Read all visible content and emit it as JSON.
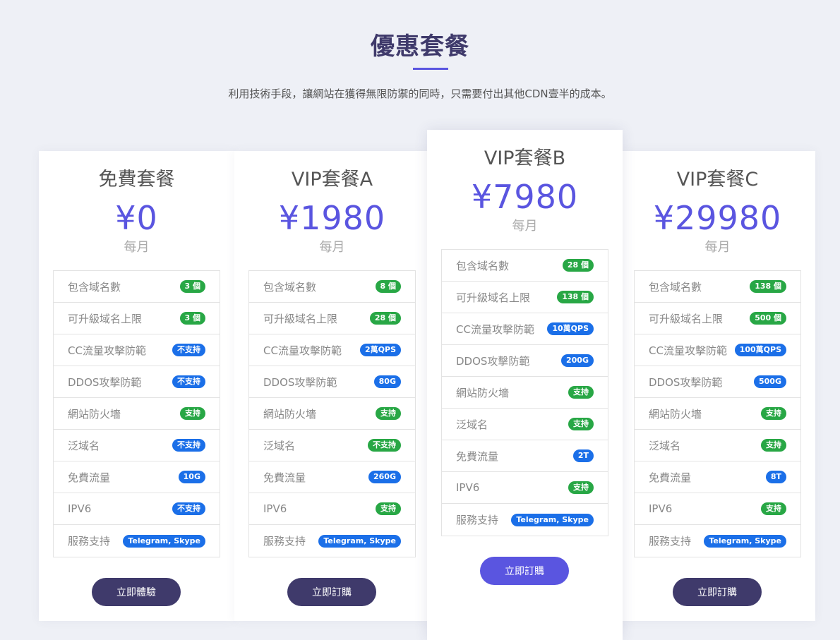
{
  "section": {
    "title": "優惠套餐",
    "subtitle": "利用技術手段，讓網站在獲得無限防禦的同時，只需要付出其他CDN壹半的成本。"
  },
  "colors": {
    "accent": "#5a55e0",
    "button_dark": "#3f3a6b",
    "badge_green": "#28a745",
    "badge_blue": "#1b6fe8"
  },
  "plans": [
    {
      "name": "免費套餐",
      "price": "¥0",
      "period": "每月",
      "button": "立即體驗",
      "features": [
        {
          "label": "包含域名數",
          "value": "3 個",
          "color": "green"
        },
        {
          "label": "可升級域名上限",
          "value": "3 個",
          "color": "green"
        },
        {
          "label": "CC流量攻擊防範",
          "value": "不支持",
          "color": "blue"
        },
        {
          "label": "DDOS攻擊防範",
          "value": "不支持",
          "color": "blue"
        },
        {
          "label": "網站防火墻",
          "value": "支持",
          "color": "green"
        },
        {
          "label": "泛域名",
          "value": "不支持",
          "color": "blue"
        },
        {
          "label": "免費流量",
          "value": "10G",
          "color": "blue"
        },
        {
          "label": "IPV6",
          "value": "不支持",
          "color": "blue"
        },
        {
          "label": "服務支持",
          "value": "Telegram, Skype",
          "color": "blue"
        }
      ]
    },
    {
      "name": "VIP套餐A",
      "price": "¥1980",
      "period": "每月",
      "button": "立即訂購",
      "features": [
        {
          "label": "包含域名數",
          "value": "8 個",
          "color": "green"
        },
        {
          "label": "可升級域名上限",
          "value": "28 個",
          "color": "green"
        },
        {
          "label": "CC流量攻擊防範",
          "value": "2萬QPS",
          "color": "blue"
        },
        {
          "label": "DDOS攻擊防範",
          "value": "80G",
          "color": "blue"
        },
        {
          "label": "網站防火墻",
          "value": "支持",
          "color": "green"
        },
        {
          "label": "泛域名",
          "value": "不支持",
          "color": "green"
        },
        {
          "label": "免費流量",
          "value": "260G",
          "color": "blue"
        },
        {
          "label": "IPV6",
          "value": "支持",
          "color": "green"
        },
        {
          "label": "服務支持",
          "value": "Telegram, Skype",
          "color": "blue"
        }
      ]
    },
    {
      "name": "VIP套餐B",
      "price": "¥7980",
      "period": "每月",
      "button": "立即訂購",
      "features": [
        {
          "label": "包含域名數",
          "value": "28 個",
          "color": "green"
        },
        {
          "label": "可升級域名上限",
          "value": "138 個",
          "color": "green"
        },
        {
          "label": "CC流量攻擊防範",
          "value": "10萬QPS",
          "color": "blue"
        },
        {
          "label": "DDOS攻擊防範",
          "value": "200G",
          "color": "blue"
        },
        {
          "label": "網站防火墻",
          "value": "支持",
          "color": "green"
        },
        {
          "label": "泛域名",
          "value": "支持",
          "color": "green"
        },
        {
          "label": "免費流量",
          "value": "2T",
          "color": "blue"
        },
        {
          "label": "IPV6",
          "value": "支持",
          "color": "green"
        },
        {
          "label": "服務支持",
          "value": "Telegram, Skype",
          "color": "blue"
        }
      ]
    },
    {
      "name": "VIP套餐C",
      "price": "¥29980",
      "period": "每月",
      "button": "立即訂購",
      "features": [
        {
          "label": "包含域名數",
          "value": "138 個",
          "color": "green"
        },
        {
          "label": "可升級域名上限",
          "value": "500 個",
          "color": "green"
        },
        {
          "label": "CC流量攻擊防範",
          "value": "100萬QPS",
          "color": "blue"
        },
        {
          "label": "DDOS攻擊防範",
          "value": "500G",
          "color": "blue"
        },
        {
          "label": "網站防火墻",
          "value": "支持",
          "color": "green"
        },
        {
          "label": "泛域名",
          "value": "支持",
          "color": "green"
        },
        {
          "label": "免費流量",
          "value": "8T",
          "color": "blue"
        },
        {
          "label": "IPV6",
          "value": "支持",
          "color": "green"
        },
        {
          "label": "服務支持",
          "value": "Telegram, Skype",
          "color": "blue"
        }
      ]
    }
  ]
}
